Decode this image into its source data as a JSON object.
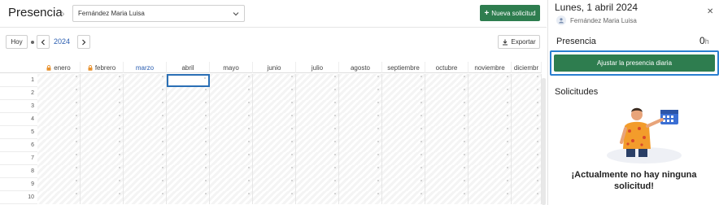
{
  "header": {
    "title": "Presencia",
    "employee": "Fernández Maria Luisa",
    "new_request_label": "Nueva solicitud"
  },
  "toolbar": {
    "today_label": "Hoy",
    "year": "2024",
    "export_label": "Exportar"
  },
  "calendar": {
    "months": [
      {
        "label": "enero",
        "locked": true,
        "current": false
      },
      {
        "label": "febrero",
        "locked": true,
        "current": false
      },
      {
        "label": "marzo",
        "locked": false,
        "current": true
      },
      {
        "label": "abril",
        "locked": false,
        "current": false
      },
      {
        "label": "mayo",
        "locked": false,
        "current": false
      },
      {
        "label": "junio",
        "locked": false,
        "current": false
      },
      {
        "label": "julio",
        "locked": false,
        "current": false
      },
      {
        "label": "agosto",
        "locked": false,
        "current": false
      },
      {
        "label": "septiembre",
        "locked": false,
        "current": false
      },
      {
        "label": "octubre",
        "locked": false,
        "current": false
      },
      {
        "label": "noviembre",
        "locked": false,
        "current": false
      },
      {
        "label": "diciembr",
        "locked": false,
        "current": false
      }
    ],
    "days": [
      "1",
      "2",
      "3",
      "4",
      "5",
      "6",
      "7",
      "8",
      "9",
      "10"
    ],
    "selected": {
      "month": "abril",
      "day": "1"
    }
  },
  "panel": {
    "date_title": "Lunes, 1 abril 2024",
    "user": "Fernández Maria Luisa",
    "presence_label": "Presencia",
    "hours_value": "0",
    "hours_unit": "h",
    "adjust_label": "Ajustar la presencia diaria",
    "requests_title": "Solicitudes",
    "empty_message": "¡Actualmente no hay ninguna solicitud!"
  },
  "colors": {
    "primary_green": "#2e7d4f",
    "accent_blue": "#2a5db0",
    "lock_orange": "#e8912d"
  },
  "icons": [
    "chevron-right-icon",
    "chevron-down-icon",
    "plus-icon",
    "chevron-left-icon",
    "download-icon",
    "lock-icon",
    "close-icon",
    "avatar-icon",
    "empty-state-illustration"
  ]
}
